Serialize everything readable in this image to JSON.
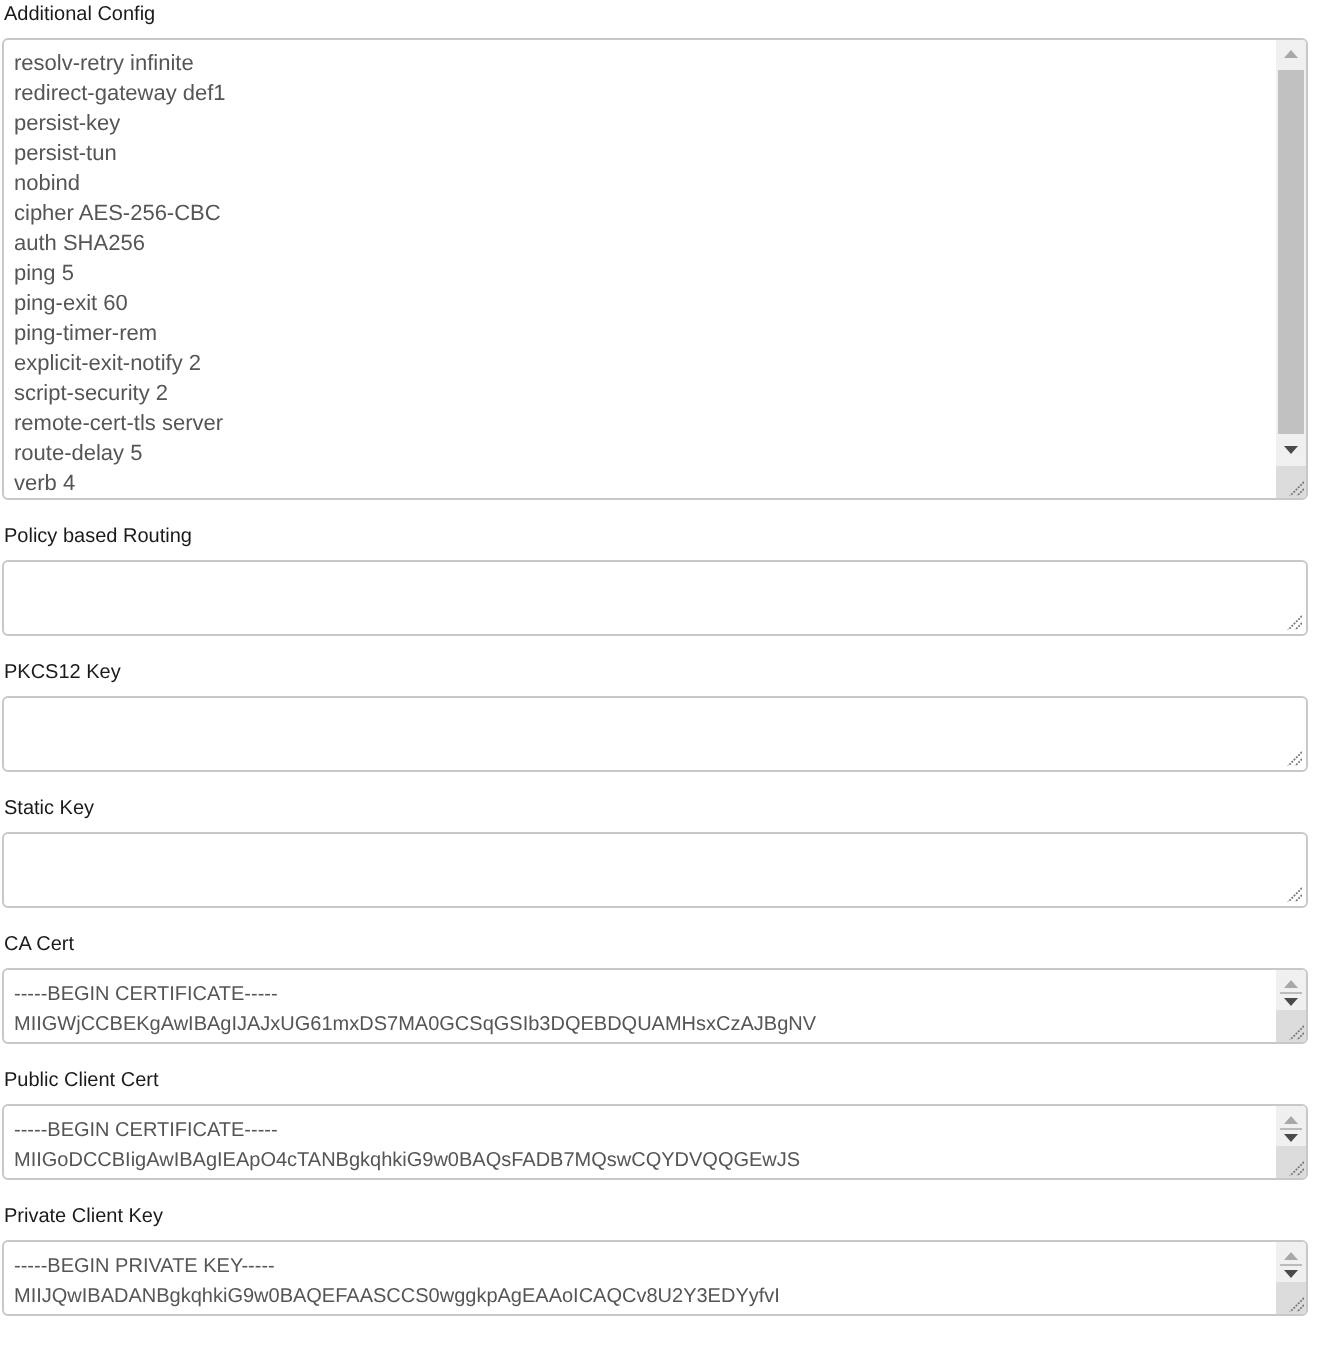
{
  "fields": [
    {
      "label": "Additional Config",
      "kind": "long",
      "lines": [
        "resolv-retry infinite",
        "redirect-gateway def1",
        "persist-key",
        "persist-tun",
        "nobind",
        "cipher AES-256-CBC",
        "auth SHA256",
        "ping 5",
        "ping-exit 60",
        "ping-timer-rem",
        "explicit-exit-notify 2",
        "script-security 2",
        "remote-cert-tls server",
        "route-delay 5",
        "verb 4"
      ]
    },
    {
      "label": "Policy based Routing",
      "kind": "empty"
    },
    {
      "label": "PKCS12 Key",
      "kind": "empty"
    },
    {
      "label": "Static Key",
      "kind": "empty"
    },
    {
      "label": "CA Cert",
      "kind": "clipped",
      "lines": [
        "-----BEGIN CERTIFICATE-----",
        "MIIGWjCCBEKgAwIBAgIJAJxUG61mxDS7MA0GCSqGSIb3DQEBDQUAMHsxCzAJBgNV"
      ]
    },
    {
      "label": "Public Client Cert",
      "kind": "clipped",
      "lines": [
        "-----BEGIN CERTIFICATE-----",
        "MIIGoDCCBIigAwIBAgIEApO4cTANBgkqhkiG9w0BAQsFADB7MQswCQYDVQQGEwJS"
      ]
    },
    {
      "label": "Private Client Key",
      "kind": "clipped",
      "lines": [
        "-----BEGIN PRIVATE KEY-----",
        "MIIJQwIBADANBgkqhkiG9w0BAQEFAASCCS0wggkpAgEAAoICAQCv8U2Y3EDYyfvI"
      ]
    }
  ]
}
